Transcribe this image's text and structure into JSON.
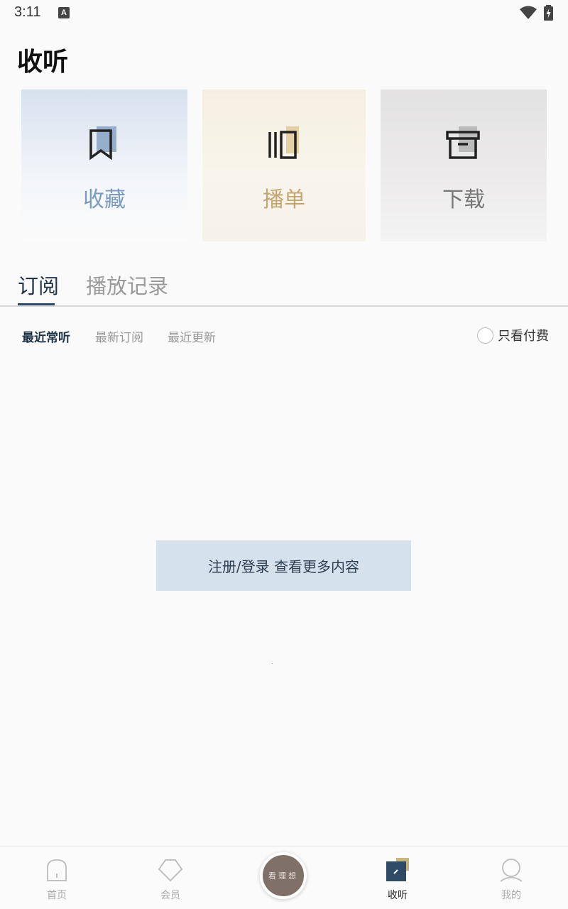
{
  "status_bar": {
    "time": "3:11",
    "notification_icon": "a-icon",
    "wifi_icon": "wifi-icon",
    "battery_icon": "battery-charging-icon"
  },
  "page": {
    "title": "收听"
  },
  "quick_cards": [
    {
      "label": "收藏",
      "icon": "bookmark-icon",
      "color": "#7a9bbd"
    },
    {
      "label": "播单",
      "icon": "playlist-icon",
      "color": "#c4a672"
    },
    {
      "label": "下载",
      "icon": "archive-box-icon",
      "color": "#777777"
    }
  ],
  "tabs": [
    {
      "label": "订阅",
      "active": true
    },
    {
      "label": "播放记录",
      "active": false
    }
  ],
  "filters": [
    {
      "label": "最近常听",
      "active": true
    },
    {
      "label": "最新订阅",
      "active": false
    },
    {
      "label": "最近更新",
      "active": false
    }
  ],
  "paid_toggle": {
    "label": "只看付费",
    "checked": false
  },
  "login_button": {
    "label": "注册/登录 查看更多内容"
  },
  "bottom_nav": {
    "items": [
      {
        "label": "首页",
        "icon": "home-icon",
        "active": false
      },
      {
        "label": "会员",
        "icon": "diamond-icon",
        "active": false
      },
      {
        "label": "收听",
        "icon": "listen-icon",
        "active": true
      },
      {
        "label": "我的",
        "icon": "user-icon",
        "active": false
      }
    ],
    "center_button": {
      "text": "看理想"
    }
  },
  "colors": {
    "accent": "#2d4a66",
    "login_bg": "#d5e2ee",
    "center_button": "#7f7169"
  }
}
